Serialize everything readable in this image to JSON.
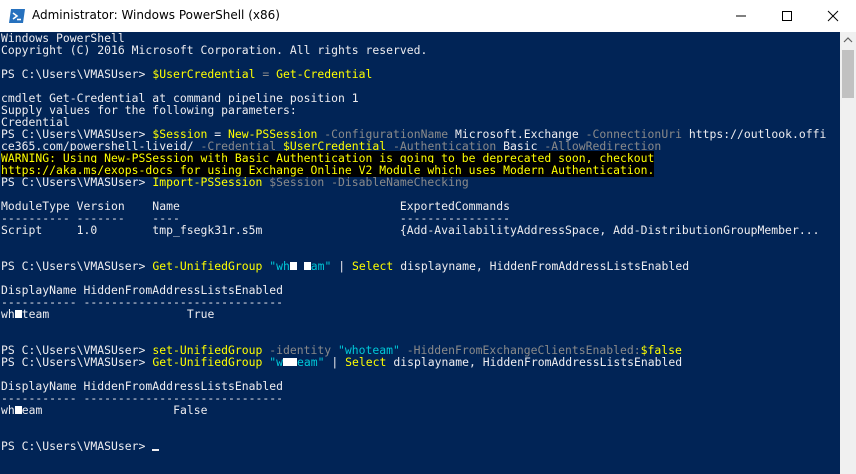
{
  "window": {
    "title": "Administrator: Windows PowerShell (x86)",
    "minimize_icon": "minimize-icon",
    "maximize_icon": "maximize-icon",
    "close_icon": "close-icon",
    "app_icon": "powershell-icon"
  },
  "colors": {
    "console_background": "#012456",
    "text": "#eeedf0",
    "command": "#ffff00",
    "parameter": "#8a8a8a",
    "string": "#00c8d8",
    "warning_background": "#000000"
  },
  "console": {
    "banner1": "Windows PowerShell",
    "banner2": "Copyright (C) 2016 Microsoft Corporation. All rights reserved.",
    "prompt": "PS C:\\Users\\VMASUser> ",
    "l1_var": "$UserCredential",
    "l1_eq": " = ",
    "l1_cmd": "Get-Credential",
    "cred1": "cmdlet Get-Credential at command pipeline position 1",
    "cred2": "Supply values for the following parameters:",
    "cred3": "Credential",
    "s_var": "$Session",
    "s_eq": " = ",
    "s_cmd": "New-PSSession",
    "s_p1": " -ConfigurationName",
    "s_v1": " Microsoft.Exchange",
    "s_p2": " -ConnectionUri",
    "s_v2a": " https://outlook.offi",
    "s_v2b": "ce365.com/powershell-liveid/",
    "s_p3": " -Credential",
    "s_v3": " $UserCredential",
    "s_p4": " -Authentication",
    "s_v4": " Basic",
    "s_p5": " -AllowRedirection",
    "warn1": "WARNING: Using New-PSSession with Basic Authentication is going to be deprecated soon, checkout",
    "warn2": "https://aka.ms/exops-docs for using Exchange Online V2 Module which uses Modern Authentication.",
    "imp_cmd": "Import-PSSession",
    "imp_var": " $Session",
    "imp_param": " -DisableNameChecking",
    "mod_header": "ModuleType Version    Name                                ExportedCommands",
    "mod_rule": "---------- -------    ----                                ----------------",
    "mod_row": "Script     1.0        tmp_fsegk31r.s5m                    {Add-AvailabilityAddressSpace, Add-DistributionGroupMember...",
    "g_cmd": "Get-UnifiedGroup",
    "g_str_open": " \"wh",
    "g_str_mid": "",
    "g_str_close": "am\"",
    "pipe": " | ",
    "sel_cmd": "Select",
    "sel_args": " displayname, HiddenFromAddressListsEnabled",
    "tbl_header": "DisplayName HiddenFromAddressListsEnabled",
    "tbl_rule": "----------- -----------------------------",
    "row1_name_a": "wh",
    "row1_name_b": "team",
    "row1_value": "                    True",
    "set_cmd": "set-UnifiedGroup",
    "set_p1": " -identity",
    "set_v1": " \"whoteam\"",
    "set_p2": " -HiddenFromExchangeClientsEnabled:",
    "set_v2": "$false",
    "g2_str_open": " \"w",
    "g2_str_close": "eam\"",
    "row2_name_a": "wh",
    "row2_name_b": "eam",
    "row2_value": "                   False",
    "last_prompt": "PS C:\\Users\\VMASUser> "
  }
}
